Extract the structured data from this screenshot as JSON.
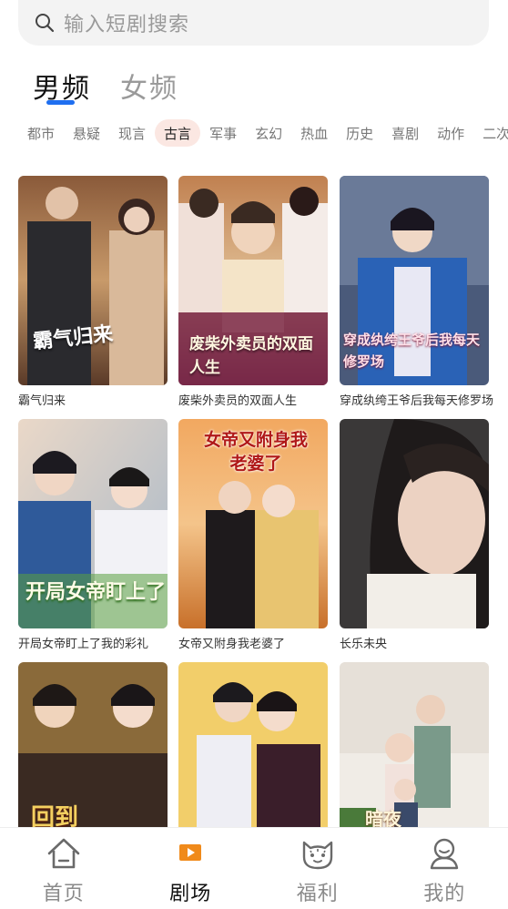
{
  "search": {
    "placeholder": "输入短剧搜索"
  },
  "gender_tabs": [
    {
      "label": "男频",
      "active": true
    },
    {
      "label": "女频",
      "active": false
    }
  ],
  "categories": [
    "都市",
    "悬疑",
    "现言",
    "古言",
    "军事",
    "玄幻",
    "热血",
    "历史",
    "喜剧",
    "动作",
    "二次元"
  ],
  "active_category": "古言",
  "shows": [
    {
      "title": "霸气归来",
      "poster_text": "霸气归来"
    },
    {
      "title": "废柴外卖员的双面人生",
      "poster_text": "废柴外卖员的双面人生"
    },
    {
      "title": "穿成纨绔王爷后我每天修罗场",
      "poster_text": "穿成纨绔王爷后我每天修罗场"
    },
    {
      "title": "开局女帝盯上了我的彩礼",
      "poster_text": "开局女帝盯上了"
    },
    {
      "title": "女帝又附身我老婆了",
      "poster_text": "女帝又附身我老婆了"
    },
    {
      "title": "长乐未央",
      "poster_text": ""
    },
    {
      "title": "",
      "poster_text": "回到"
    },
    {
      "title": "",
      "poster_text": ""
    },
    {
      "title": "",
      "poster_text": "暗夜"
    }
  ],
  "bottom_nav": [
    {
      "label": "首页",
      "icon": "home-icon",
      "active": false
    },
    {
      "label": "剧场",
      "icon": "theater-play-icon",
      "active": true
    },
    {
      "label": "福利",
      "icon": "cat-face-icon",
      "active": false
    },
    {
      "label": "我的",
      "icon": "profile-icon",
      "active": false
    }
  ],
  "colors": {
    "accent": "#1f6ff0",
    "active_chip": "#fbe7e2",
    "theater_icon": "#f08a1a"
  }
}
